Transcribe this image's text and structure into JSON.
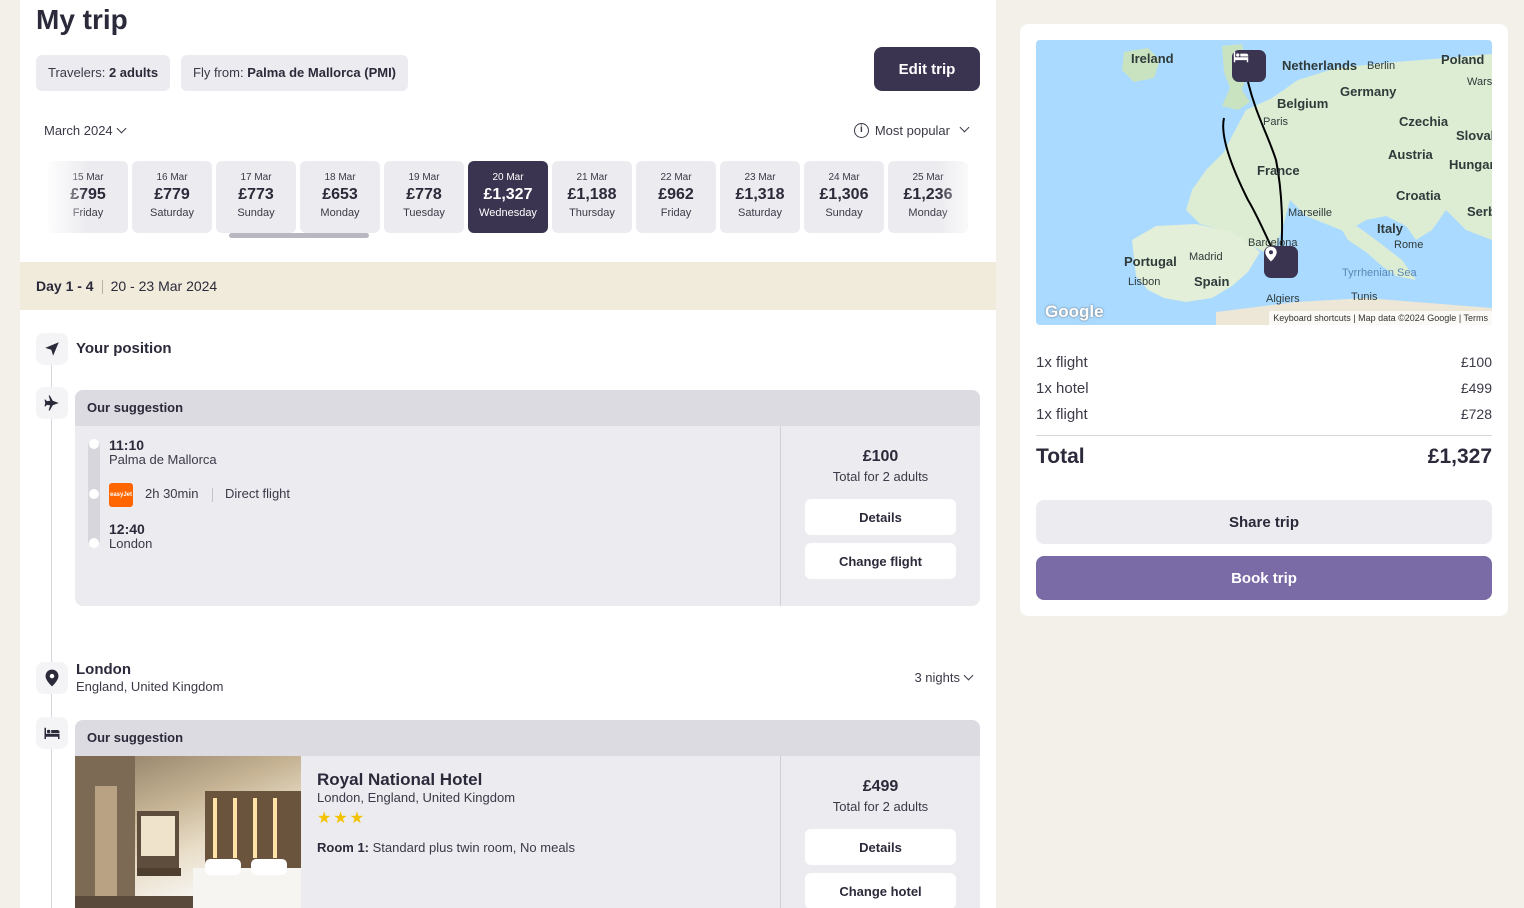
{
  "page": {
    "title": "My trip"
  },
  "trip_info": {
    "travelers_label": "Travelers:",
    "travelers_value": "2 adults",
    "fly_from_label": "Fly from:",
    "fly_from_value": "Palma de Mallorca (PMI)",
    "edit_label": "Edit trip"
  },
  "filters": {
    "month": "March 2024",
    "sort": "Most popular"
  },
  "dates": [
    {
      "date": "15 Mar",
      "price": "£795",
      "weekday": "Friday"
    },
    {
      "date": "16 Mar",
      "price": "£779",
      "weekday": "Saturday"
    },
    {
      "date": "17 Mar",
      "price": "£773",
      "weekday": "Sunday"
    },
    {
      "date": "18 Mar",
      "price": "£653",
      "weekday": "Monday"
    },
    {
      "date": "19 Mar",
      "price": "£778",
      "weekday": "Tuesday"
    },
    {
      "date": "20 Mar",
      "price": "£1,327",
      "weekday": "Wednesday",
      "selected": true
    },
    {
      "date": "21 Mar",
      "price": "£1,188",
      "weekday": "Thursday"
    },
    {
      "date": "22 Mar",
      "price": "£962",
      "weekday": "Friday"
    },
    {
      "date": "23 Mar",
      "price": "£1,318",
      "weekday": "Saturday"
    },
    {
      "date": "24 Mar",
      "price": "£1,306",
      "weekday": "Sunday"
    },
    {
      "date": "25 Mar",
      "price": "£1,236",
      "weekday": "Monday"
    }
  ],
  "day_band": {
    "days": "Day 1 - 4",
    "range": "20 - 23 Mar 2024"
  },
  "position": {
    "label": "Your position"
  },
  "flight": {
    "header": "Our suggestion",
    "depart_time": "11:10",
    "depart_place": "Palma de Mallorca",
    "airline_logo_text": "easyJet",
    "duration": "2h 30min",
    "type": "Direct flight",
    "arrive_time": "12:40",
    "arrive_place": "London",
    "price": "£100",
    "price_note": "Total for 2 adults",
    "details_label": "Details",
    "change_label": "Change flight"
  },
  "destination": {
    "city": "London",
    "country": "England, United Kingdom",
    "nights": "3 nights"
  },
  "hotel": {
    "header": "Our suggestion",
    "name": "Royal National Hotel",
    "location": "London, England, United Kingdom",
    "stars": "★★★",
    "room_label": "Room 1:",
    "room_value": "Standard plus twin room, No meals",
    "price": "£499",
    "price_note": "Total for 2 adults",
    "details_label": "Details",
    "change_label": "Change hotel"
  },
  "map": {
    "labels": {
      "ireland": "Ireland",
      "netherlands": "Netherlands",
      "berlin": "Berlin",
      "poland": "Poland",
      "warsaw": "Wars",
      "germany": "Germany",
      "belgium": "Belgium",
      "paris": "Paris",
      "czechia": "Czechia",
      "slovakia": "Slovak",
      "austria": "Austria",
      "hungary": "Hungar",
      "france": "France",
      "croatia": "Croatia",
      "serbia": "Serb",
      "marseille": "Marseille",
      "italy": "Italy",
      "rome": "Rome",
      "barcelona": "Barcelona",
      "portugal": "Portugal",
      "madrid": "Madrid",
      "spain": "Spain",
      "lisbon": "Lisbon",
      "tyrrhenian": "Tyrrhenian Sea",
      "algiers": "Algiers",
      "tunis": "Tunis"
    },
    "google": "Google",
    "footer": "Keyboard shortcuts  |  Map data ©2024 Google  |  Terms"
  },
  "summary": {
    "items": [
      {
        "label": "1x flight",
        "value": "£100"
      },
      {
        "label": "1x hotel",
        "value": "£499"
      },
      {
        "label": "1x flight",
        "value": "£728"
      }
    ],
    "total_label": "Total",
    "total_value": "£1,327",
    "share_label": "Share trip",
    "book_label": "Book trip"
  },
  "colors": {
    "primary": "#3b3450",
    "book": "#7a6aa6",
    "day_band": "#f1ebdc",
    "star": "#f2c200",
    "easyjet": "#ff6600"
  },
  "icons": [
    "chevron-down-icon",
    "info-icon",
    "navigation-arrow-icon",
    "plane-icon",
    "location-pin-icon",
    "bed-icon"
  ]
}
